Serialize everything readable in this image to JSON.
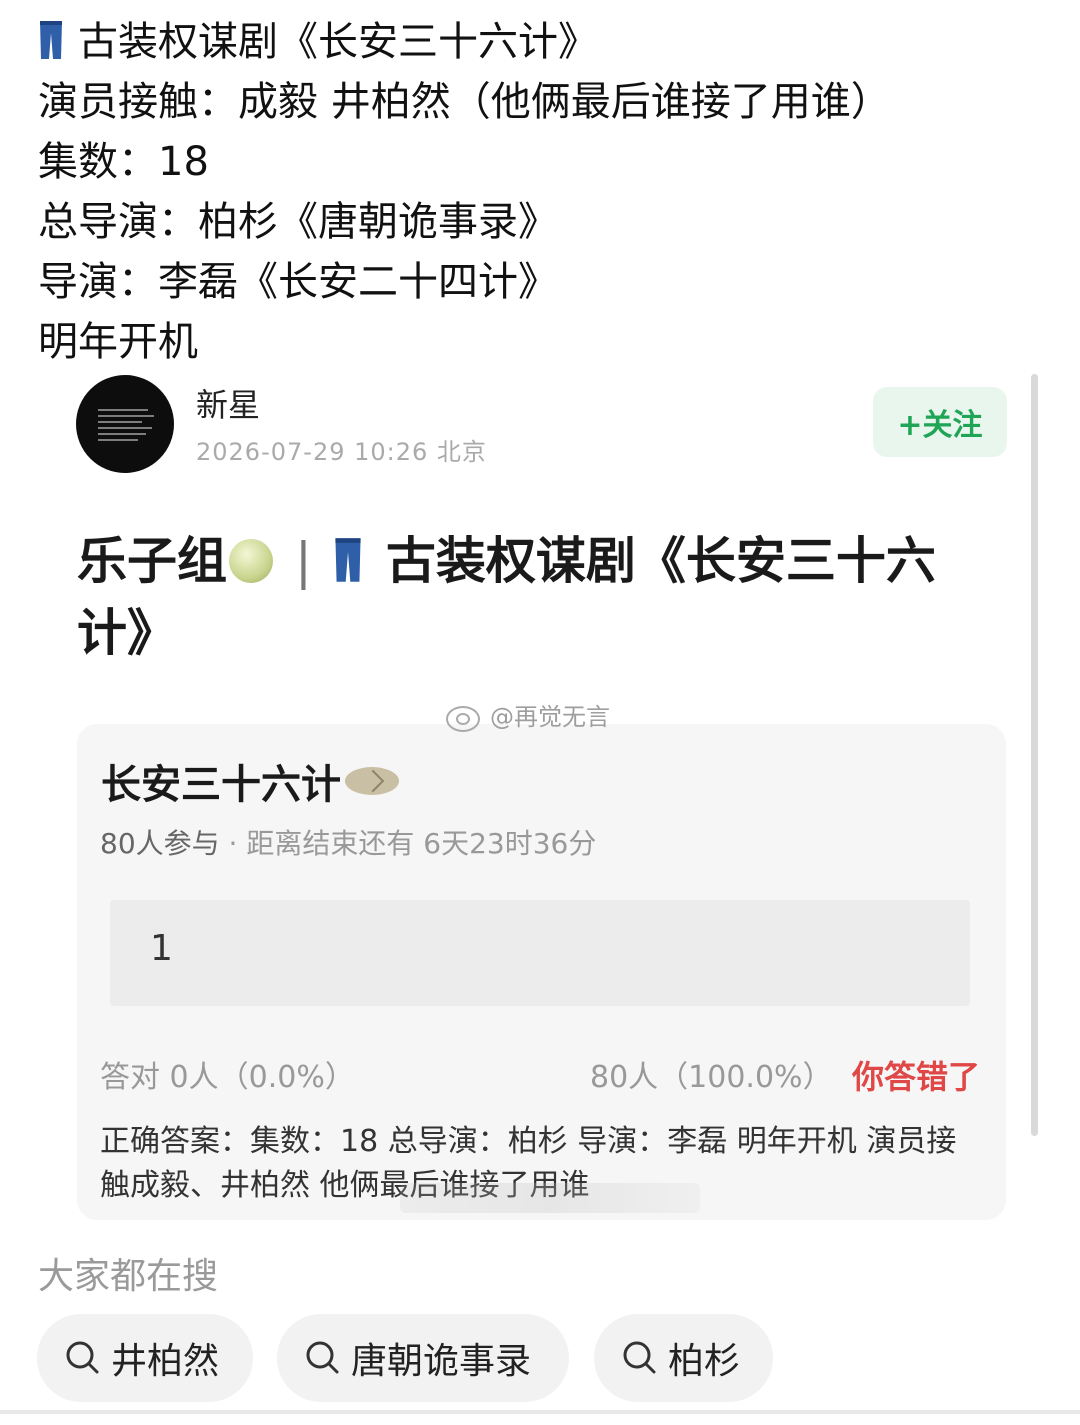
{
  "post": {
    "lines": [
      "古装权谋剧《长安三十六计》",
      "演员接触：成毅 井柏然（他俩最后谁接了用谁）",
      "集数：18",
      "总导演：柏杉《唐朝诡事录》",
      "导演：李磊《长安二十四计》",
      "明年开机"
    ],
    "first_line_emoji": "jeans-icon"
  },
  "card": {
    "author": "新星",
    "meta": "2026-07-29 10:26 北京",
    "follow_label": "+关注",
    "title_prefix": "乐子组",
    "title_separator": "|",
    "title_main": "古装权谋剧《长安三十六计》",
    "watermark": "@再觉无言"
  },
  "quiz": {
    "title": "长安三十六计",
    "participants": "80人参与",
    "dot": "·",
    "countdown": "距离结束还有 6天23时36分",
    "option": "1",
    "correct_stat": "答对 0人（0.0%）",
    "other_stat": "80人（100.0%）",
    "result": "你答错了",
    "answer": "正确答案：集数：18 总导演：柏杉 导演：李磊 明年开机 演员接触成毅、井柏然 他俩最后谁接了用谁"
  },
  "search": {
    "label": "大家都在搜",
    "tags": [
      "井柏然",
      "唐朝诡事录",
      "柏杉"
    ]
  },
  "colors": {
    "follow_green": "#1fa555",
    "wrong_red": "#e04848",
    "jeans_blue": "#2f5fa8"
  }
}
